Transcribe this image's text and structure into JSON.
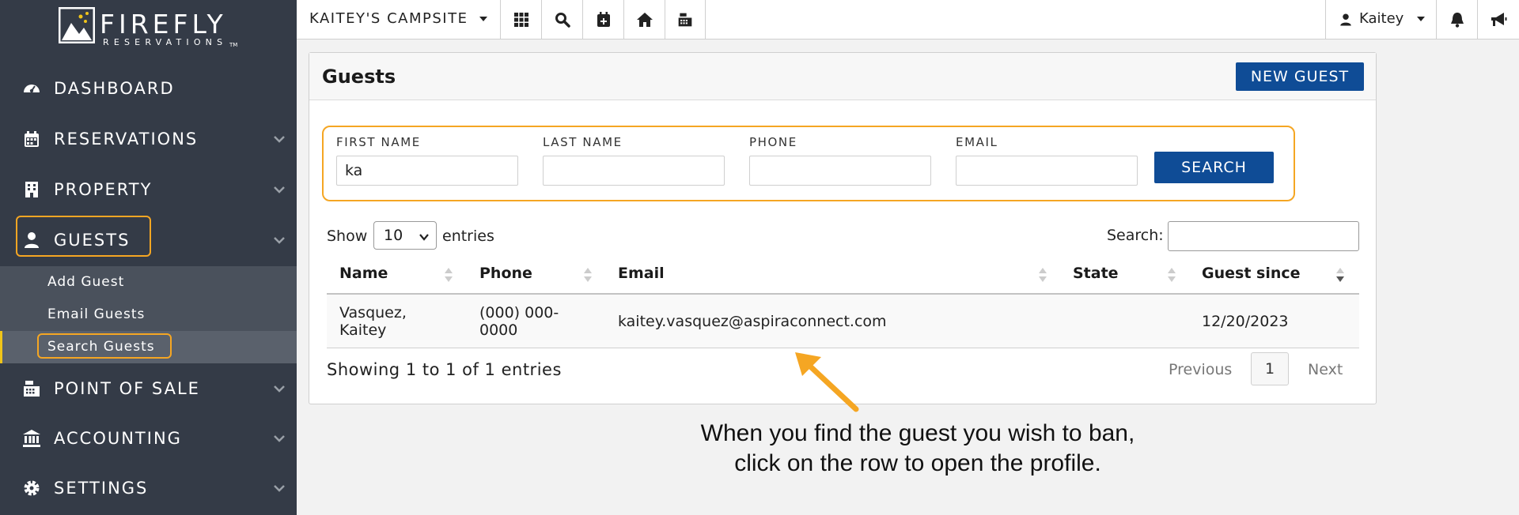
{
  "brand": {
    "word": "FIREFLY",
    "sub": "RESERVATIONS",
    "tm": "TM"
  },
  "sidebar": {
    "items": [
      {
        "label": "DASHBOARD",
        "icon": "dashboard-icon"
      },
      {
        "label": "RESERVATIONS",
        "icon": "calendar-icon"
      },
      {
        "label": "PROPERTY",
        "icon": "building-icon"
      },
      {
        "label": "GUESTS",
        "icon": "user-icon"
      },
      {
        "label": "POINT OF SALE",
        "icon": "cash-register-icon"
      },
      {
        "label": "ACCOUNTING",
        "icon": "bank-icon"
      },
      {
        "label": "SETTINGS",
        "icon": "gear-icon"
      }
    ],
    "guest_sub": [
      "Add Guest",
      "Email Guests",
      "Search Guests"
    ]
  },
  "topbar": {
    "campsite": "KAITEY'S CAMPSITE",
    "user": "Kaitey"
  },
  "card": {
    "title": "Guests",
    "new_button": "NEW GUEST"
  },
  "filters": {
    "first_name_label": "FIRST NAME",
    "first_name_value": "ka",
    "last_name_label": "LAST NAME",
    "last_name_value": "",
    "phone_label": "PHONE",
    "phone_value": "",
    "email_label": "EMAIL",
    "email_value": "",
    "search_button": "SEARCH"
  },
  "table": {
    "show": "Show",
    "entries_value": "10",
    "entries": "entries",
    "search_label": "Search:",
    "columns": [
      "Name",
      "Phone",
      "Email",
      "State",
      "Guest since"
    ],
    "rows": [
      {
        "name_1": "Vasquez,",
        "name_2": "Kaitey",
        "phone_1": "(000) 000-",
        "phone_2": "0000",
        "email": "kaitey.vasquez@aspiraconnect.com",
        "state": "",
        "since": "12/20/2023"
      }
    ],
    "info": "Showing 1 to 1 of 1 entries",
    "prev": "Previous",
    "page": "1",
    "next": "Next"
  },
  "annotation": {
    "line1": "When you find the guest you wish to ban,",
    "line2": "click on the row to open the profile."
  },
  "colors": {
    "sidebar": "#343b47",
    "primary": "#0f4c96",
    "highlight": "#f5a623"
  }
}
